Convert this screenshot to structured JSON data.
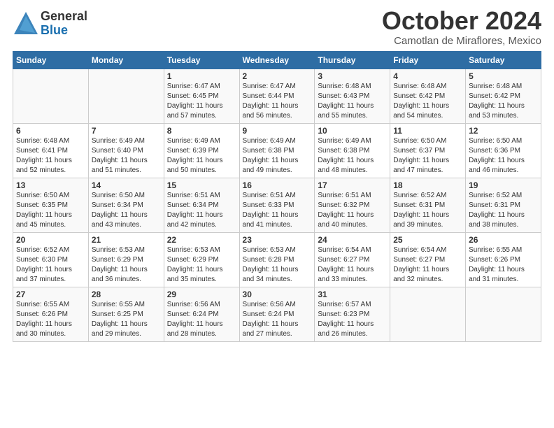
{
  "logo": {
    "general": "General",
    "blue": "Blue"
  },
  "title": "October 2024",
  "subtitle": "Camotlan de Miraflores, Mexico",
  "days_of_week": [
    "Sunday",
    "Monday",
    "Tuesday",
    "Wednesday",
    "Thursday",
    "Friday",
    "Saturday"
  ],
  "weeks": [
    [
      {
        "day": "",
        "info": ""
      },
      {
        "day": "",
        "info": ""
      },
      {
        "day": "1",
        "info": "Sunrise: 6:47 AM\nSunset: 6:45 PM\nDaylight: 11 hours and 57 minutes."
      },
      {
        "day": "2",
        "info": "Sunrise: 6:47 AM\nSunset: 6:44 PM\nDaylight: 11 hours and 56 minutes."
      },
      {
        "day": "3",
        "info": "Sunrise: 6:48 AM\nSunset: 6:43 PM\nDaylight: 11 hours and 55 minutes."
      },
      {
        "day": "4",
        "info": "Sunrise: 6:48 AM\nSunset: 6:42 PM\nDaylight: 11 hours and 54 minutes."
      },
      {
        "day": "5",
        "info": "Sunrise: 6:48 AM\nSunset: 6:42 PM\nDaylight: 11 hours and 53 minutes."
      }
    ],
    [
      {
        "day": "6",
        "info": "Sunrise: 6:48 AM\nSunset: 6:41 PM\nDaylight: 11 hours and 52 minutes."
      },
      {
        "day": "7",
        "info": "Sunrise: 6:49 AM\nSunset: 6:40 PM\nDaylight: 11 hours and 51 minutes."
      },
      {
        "day": "8",
        "info": "Sunrise: 6:49 AM\nSunset: 6:39 PM\nDaylight: 11 hours and 50 minutes."
      },
      {
        "day": "9",
        "info": "Sunrise: 6:49 AM\nSunset: 6:38 PM\nDaylight: 11 hours and 49 minutes."
      },
      {
        "day": "10",
        "info": "Sunrise: 6:49 AM\nSunset: 6:38 PM\nDaylight: 11 hours and 48 minutes."
      },
      {
        "day": "11",
        "info": "Sunrise: 6:50 AM\nSunset: 6:37 PM\nDaylight: 11 hours and 47 minutes."
      },
      {
        "day": "12",
        "info": "Sunrise: 6:50 AM\nSunset: 6:36 PM\nDaylight: 11 hours and 46 minutes."
      }
    ],
    [
      {
        "day": "13",
        "info": "Sunrise: 6:50 AM\nSunset: 6:35 PM\nDaylight: 11 hours and 45 minutes."
      },
      {
        "day": "14",
        "info": "Sunrise: 6:50 AM\nSunset: 6:34 PM\nDaylight: 11 hours and 43 minutes."
      },
      {
        "day": "15",
        "info": "Sunrise: 6:51 AM\nSunset: 6:34 PM\nDaylight: 11 hours and 42 minutes."
      },
      {
        "day": "16",
        "info": "Sunrise: 6:51 AM\nSunset: 6:33 PM\nDaylight: 11 hours and 41 minutes."
      },
      {
        "day": "17",
        "info": "Sunrise: 6:51 AM\nSunset: 6:32 PM\nDaylight: 11 hours and 40 minutes."
      },
      {
        "day": "18",
        "info": "Sunrise: 6:52 AM\nSunset: 6:31 PM\nDaylight: 11 hours and 39 minutes."
      },
      {
        "day": "19",
        "info": "Sunrise: 6:52 AM\nSunset: 6:31 PM\nDaylight: 11 hours and 38 minutes."
      }
    ],
    [
      {
        "day": "20",
        "info": "Sunrise: 6:52 AM\nSunset: 6:30 PM\nDaylight: 11 hours and 37 minutes."
      },
      {
        "day": "21",
        "info": "Sunrise: 6:53 AM\nSunset: 6:29 PM\nDaylight: 11 hours and 36 minutes."
      },
      {
        "day": "22",
        "info": "Sunrise: 6:53 AM\nSunset: 6:29 PM\nDaylight: 11 hours and 35 minutes."
      },
      {
        "day": "23",
        "info": "Sunrise: 6:53 AM\nSunset: 6:28 PM\nDaylight: 11 hours and 34 minutes."
      },
      {
        "day": "24",
        "info": "Sunrise: 6:54 AM\nSunset: 6:27 PM\nDaylight: 11 hours and 33 minutes."
      },
      {
        "day": "25",
        "info": "Sunrise: 6:54 AM\nSunset: 6:27 PM\nDaylight: 11 hours and 32 minutes."
      },
      {
        "day": "26",
        "info": "Sunrise: 6:55 AM\nSunset: 6:26 PM\nDaylight: 11 hours and 31 minutes."
      }
    ],
    [
      {
        "day": "27",
        "info": "Sunrise: 6:55 AM\nSunset: 6:26 PM\nDaylight: 11 hours and 30 minutes."
      },
      {
        "day": "28",
        "info": "Sunrise: 6:55 AM\nSunset: 6:25 PM\nDaylight: 11 hours and 29 minutes."
      },
      {
        "day": "29",
        "info": "Sunrise: 6:56 AM\nSunset: 6:24 PM\nDaylight: 11 hours and 28 minutes."
      },
      {
        "day": "30",
        "info": "Sunrise: 6:56 AM\nSunset: 6:24 PM\nDaylight: 11 hours and 27 minutes."
      },
      {
        "day": "31",
        "info": "Sunrise: 6:57 AM\nSunset: 6:23 PM\nDaylight: 11 hours and 26 minutes."
      },
      {
        "day": "",
        "info": ""
      },
      {
        "day": "",
        "info": ""
      }
    ]
  ]
}
